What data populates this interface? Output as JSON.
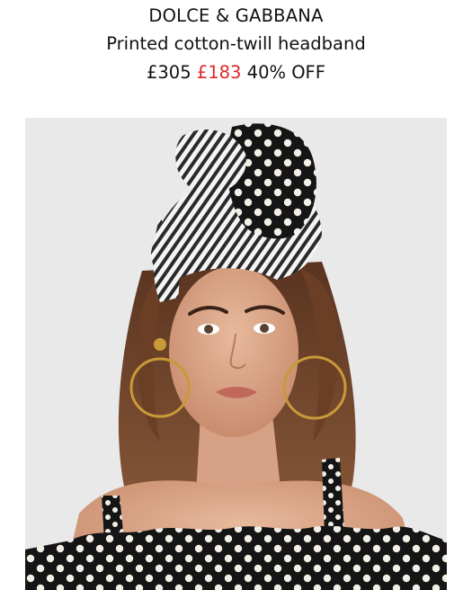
{
  "product": {
    "brand": "DOLCE & GABBANA",
    "name": "Printed cotton-twill headband",
    "price_original": "£305",
    "price_sale": "£183",
    "discount": "40% OFF"
  },
  "colors": {
    "sale_price": "#e0262b",
    "background": "#ffffff",
    "photo_background": "#e9e9e9"
  },
  "image": {
    "subject": "model-wearing-headband"
  }
}
